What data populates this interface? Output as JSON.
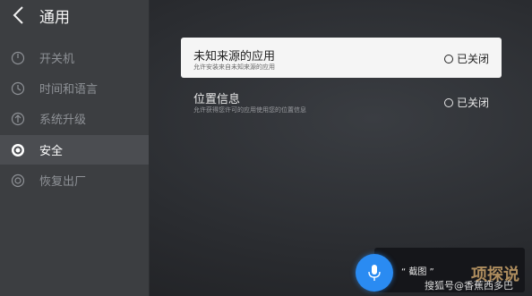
{
  "header": {
    "title": "通用"
  },
  "sidebar": {
    "items": [
      {
        "label": "开关机",
        "icon": "power-icon"
      },
      {
        "label": "时间和语言",
        "icon": "clock-icon"
      },
      {
        "label": "系统升级",
        "icon": "upgrade-arrow-icon"
      },
      {
        "label": "安全",
        "icon": "shield-target-icon",
        "active": true
      },
      {
        "label": "恢复出厂",
        "icon": "reset-icon"
      }
    ]
  },
  "settings": [
    {
      "title": "未知来源的应用",
      "subtitle": "允许安装来自未知来源的应用",
      "status": "已关闭",
      "focused": true
    },
    {
      "title": "位置信息",
      "subtitle": "允许获得您许可的应用使用您的位置信息",
      "status": "已关闭",
      "focused": false
    }
  ],
  "voice": {
    "text": "“ 截图 ”"
  },
  "watermark": {
    "text": "搜狐号@香蕉西多巴",
    "logo_text": "项探说"
  },
  "colors": {
    "mic": "#2a8bf2",
    "sidebar": "#3c3e41",
    "active_item": "#4b4d51"
  }
}
